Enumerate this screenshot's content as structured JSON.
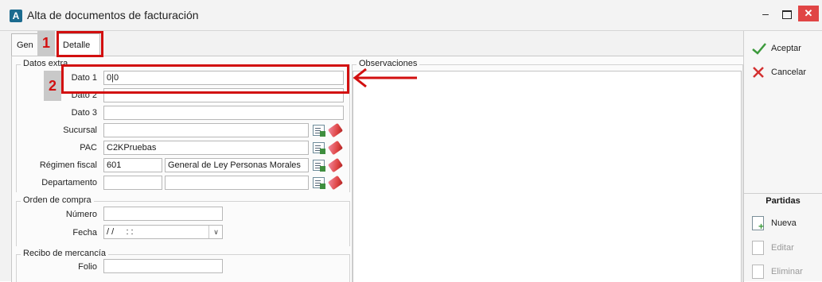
{
  "window": {
    "title": "Alta de documentos de facturación",
    "app_icon_letter": "A",
    "minimize": "–",
    "close": "✕"
  },
  "tabs": [
    {
      "label": "Gen"
    },
    {
      "label": "Detalle"
    }
  ],
  "callouts": [
    {
      "label": "1"
    },
    {
      "label": "2"
    }
  ],
  "datos_extra": {
    "group_title": "Datos extra",
    "fields": [
      {
        "label": "Dato 1",
        "value": "0|0"
      },
      {
        "label": "Dato 2",
        "value": ""
      },
      {
        "label": "Dato 3",
        "value": ""
      },
      {
        "label": "Sucursal",
        "value": ""
      },
      {
        "label": "PAC",
        "value": "C2KPruebas"
      },
      {
        "label": "Régimen fiscal",
        "code": "601",
        "value": "General de Ley Personas Morales"
      },
      {
        "label": "Departamento",
        "code": "",
        "value": ""
      }
    ]
  },
  "orden_compra": {
    "group_title": "Orden de compra",
    "numero_label": "Número",
    "numero_value": "",
    "fecha_label": "Fecha",
    "fecha_value": "/ /     : :"
  },
  "recibo_mercancia": {
    "group_title": "Recibo de mercancía",
    "folio_label": "Folio",
    "folio_value": ""
  },
  "observaciones": {
    "title": "Observaciones",
    "value": ""
  },
  "actions": {
    "accept": "Aceptar",
    "cancel": "Cancelar"
  },
  "partidas": {
    "title": "Partidas",
    "items": [
      "Nueva",
      "Editar",
      "Eliminar"
    ]
  },
  "colors": {
    "callout_red": "#d20f0f",
    "accept_green": "#3c9a3c",
    "cancel_red": "#d33030"
  }
}
